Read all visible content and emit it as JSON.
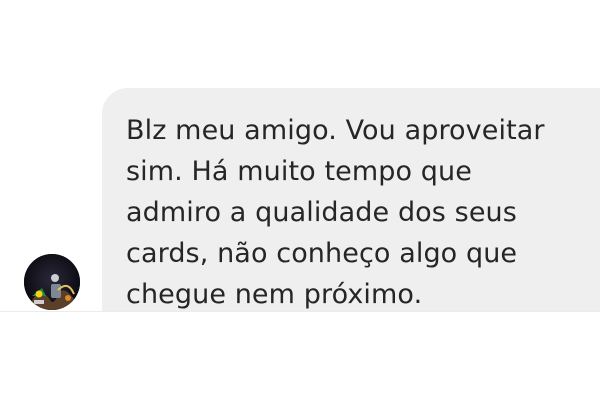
{
  "conversation": {
    "incoming_message": {
      "text": "Blz meu amigo. Vou aproveitar\nsim. Há muito tempo que\nadmiro a qualidade dos seus\ncards, não conheço algo que\nchegue nem próximo.",
      "bubble_color": "#efefef",
      "text_color": "#262626"
    },
    "sender_avatar": {
      "icon": "profile-photo-icon"
    }
  }
}
